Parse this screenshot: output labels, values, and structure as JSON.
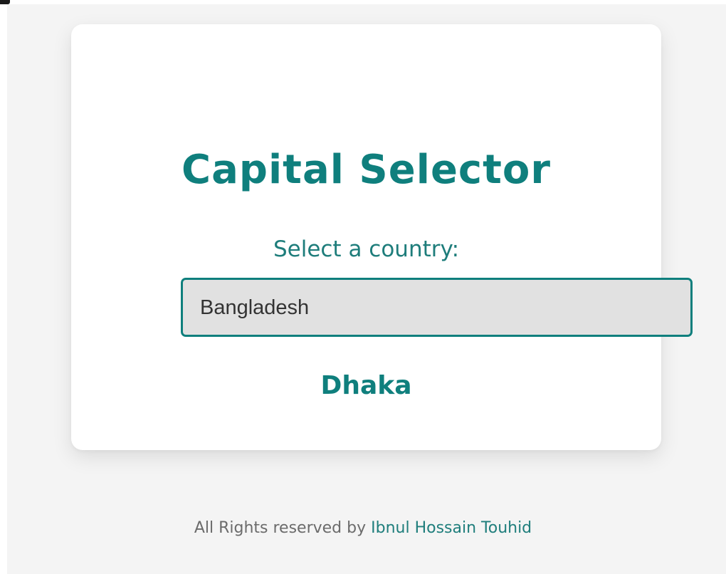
{
  "app": {
    "title": "Capital Selector"
  },
  "selector": {
    "label": "Select a country:",
    "selected_value": "Bangladesh"
  },
  "result": {
    "capital": "Dhaka"
  },
  "footer": {
    "text": "All Rights reserved by",
    "author": "Ibnul Hossain Touhid"
  },
  "colors": {
    "accent": "#0f7f7d",
    "page_background": "#f4f4f4",
    "card_background": "#ffffff",
    "select_background": "#e1e1e1",
    "footer_text": "#6b6b6b"
  }
}
